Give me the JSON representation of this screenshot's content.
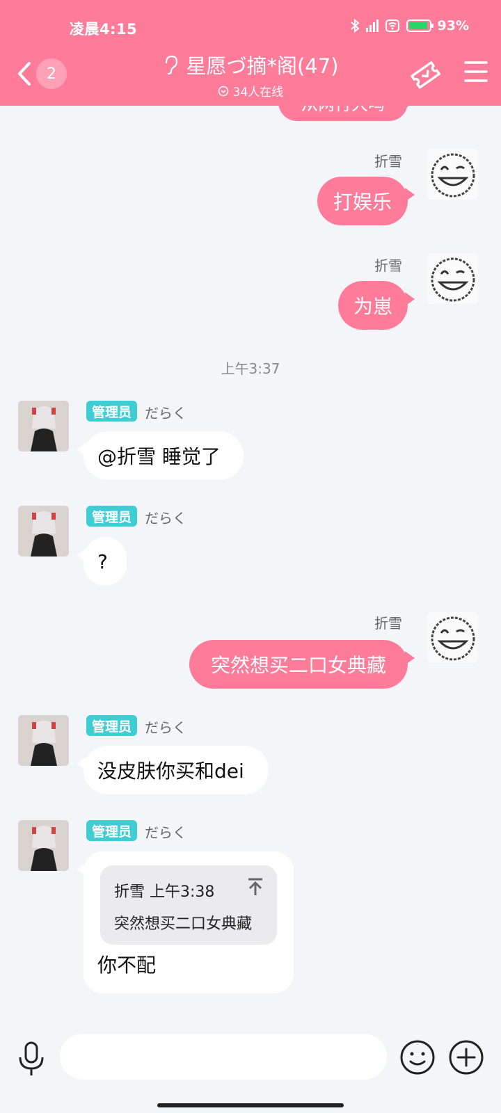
{
  "status_bar": {
    "time": "凌晨4:15",
    "battery": "93%"
  },
  "header": {
    "back_badge": "2",
    "title": "星愿づ摘*阁(47)",
    "online": "34人在线"
  },
  "messages": {
    "top_partial": "从两行大吗",
    "m1": {
      "sender": "折雪",
      "text": "打娱乐"
    },
    "m2": {
      "sender": "折雪",
      "text": "为崽"
    },
    "time1": "上午3:37",
    "m3": {
      "badge": "管理员",
      "sender": "だらく",
      "text": "@折雪 睡觉了"
    },
    "m4": {
      "badge": "管理员",
      "sender": "だらく",
      "text": "?"
    },
    "m5": {
      "sender": "折雪",
      "text": "突然想买二口女典藏"
    },
    "m6": {
      "badge": "管理员",
      "sender": "だらく",
      "text": "没皮肤你买和dei"
    },
    "m7": {
      "badge": "管理员",
      "sender": "だらく",
      "quote_head": "折雪 上午3:38",
      "quote_text": "突然想买二口女典藏",
      "text": "你不配"
    }
  },
  "input": {
    "placeholder": ""
  },
  "colors": {
    "accent": "#fe7c9a",
    "admin": "#3fcdd3",
    "background": "#f4f5f9"
  },
  "icons": [
    "back-icon",
    "ear-icon",
    "online-icon",
    "ticket-icon",
    "menu-icon",
    "mic-icon",
    "emoji-icon",
    "plus-icon",
    "jump-up-icon",
    "bluetooth-icon",
    "wifi-icon",
    "battery-icon"
  ]
}
